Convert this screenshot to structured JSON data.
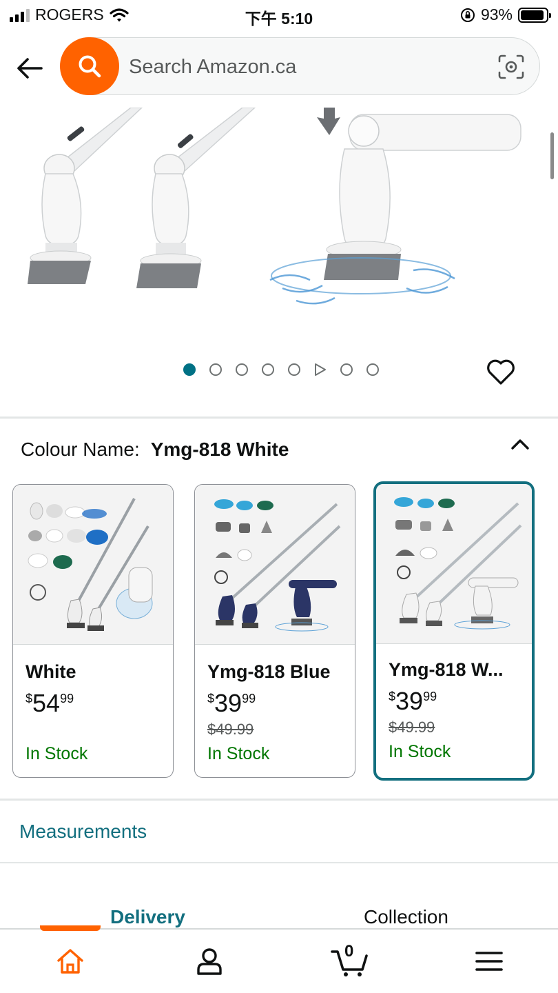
{
  "status_bar": {
    "carrier": "ROGERS",
    "time": "下午 5:10",
    "battery": "93%"
  },
  "search": {
    "placeholder": "Search Amazon.ca"
  },
  "gallery": {
    "image_count": 8,
    "active_index": 0,
    "video_index": 5
  },
  "colour": {
    "label": "Colour Name:",
    "selected": "Ymg-818 White"
  },
  "variants": [
    {
      "title": "White",
      "currency": "$",
      "whole": "54",
      "fraction": "99",
      "was": "",
      "stock": "In Stock"
    },
    {
      "title": "Ymg-818 Blue",
      "currency": "$",
      "whole": "39",
      "fraction": "99",
      "was": "$49.99",
      "stock": "In Stock"
    },
    {
      "title": "Ymg-818 W...",
      "currency": "$",
      "whole": "39",
      "fraction": "99",
      "was": "$49.99",
      "stock": "In Stock"
    }
  ],
  "measurements_link": "Measurements",
  "fulfilment_tabs": {
    "delivery": "Delivery",
    "collection": "Collection"
  },
  "cart_count": "0",
  "colors": {
    "accent_orange": "#ff6200",
    "teal": "#136f7f",
    "stock_green": "#007600"
  },
  "icons": [
    "back-arrow-icon",
    "search-icon",
    "camera-scan-icon",
    "heart-icon",
    "chevron-up-icon",
    "home-icon",
    "account-icon",
    "cart-icon",
    "menu-icon"
  ]
}
